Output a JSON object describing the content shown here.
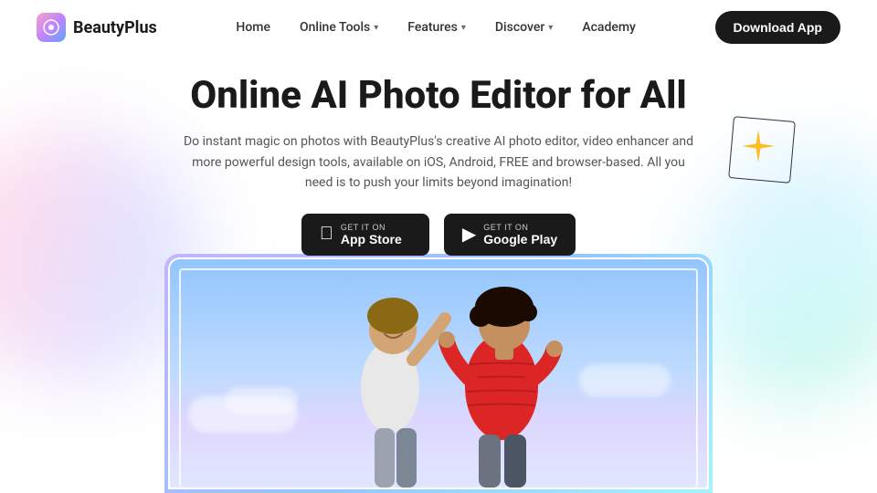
{
  "brand": {
    "name": "BeautyPlus",
    "logo_alt": "BeautyPlus logo"
  },
  "nav": {
    "links": [
      {
        "label": "Home",
        "has_dropdown": false
      },
      {
        "label": "Online Tools",
        "has_dropdown": true
      },
      {
        "label": "Features",
        "has_dropdown": true
      },
      {
        "label": "Discover",
        "has_dropdown": true
      },
      {
        "label": "Academy",
        "has_dropdown": false
      }
    ],
    "download_label": "Download App"
  },
  "hero": {
    "title": "Online AI Photo Editor for All",
    "description": "Do instant magic on photos with BeautyPlus's creative AI photo editor, video enhancer and more powerful design tools, available on iOS, Android, FREE and browser-based. All you need is to push your limits beyond imagination!",
    "app_store_small": "GET IT ON",
    "app_store_label": "App Store",
    "google_play_small": "GET IT ON",
    "google_play_label": "Google Play"
  }
}
